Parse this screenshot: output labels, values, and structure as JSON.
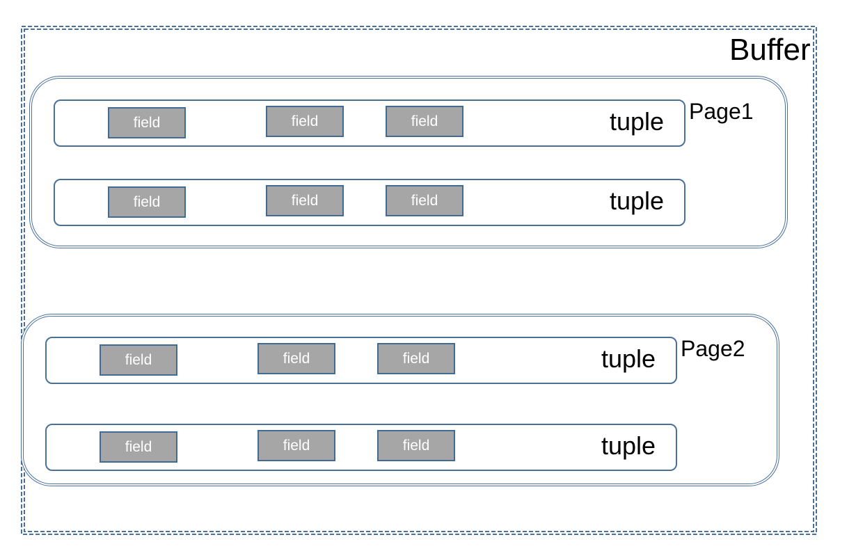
{
  "diagram": {
    "buffer": {
      "label": "Buffer",
      "pages": [
        {
          "label": "Page1",
          "tuples": [
            {
              "label": "tuple",
              "fields": [
                "field",
                "field",
                "field"
              ]
            },
            {
              "label": "tuple",
              "fields": [
                "field",
                "field",
                "field"
              ]
            }
          ]
        },
        {
          "label": "Page2",
          "tuples": [
            {
              "label": "tuple",
              "fields": [
                "field",
                "field",
                "field"
              ]
            },
            {
              "label": "tuple",
              "fields": [
                "field",
                "field",
                "field"
              ]
            }
          ]
        }
      ]
    },
    "colors": {
      "border": "#4a709a",
      "field_fill": "#a6a6a6",
      "field_text": "#ffffff"
    }
  }
}
